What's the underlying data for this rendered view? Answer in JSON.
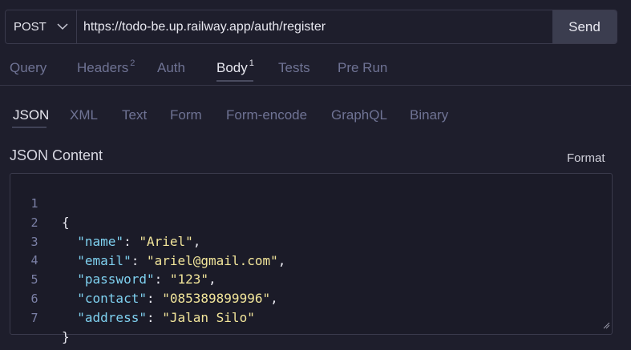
{
  "request": {
    "method": "POST",
    "url": "https://todo-be.up.railway.app/auth/register",
    "send_label": "Send"
  },
  "tabs": [
    {
      "label": "Query",
      "badge": ""
    },
    {
      "label": "Headers",
      "badge": "2"
    },
    {
      "label": "Auth",
      "badge": ""
    },
    {
      "label": "Body",
      "badge": "1"
    },
    {
      "label": "Tests",
      "badge": ""
    },
    {
      "label": "Pre Run",
      "badge": ""
    }
  ],
  "active_tab": "Body",
  "body_types": [
    "JSON",
    "XML",
    "Text",
    "Form",
    "Form-encode",
    "GraphQL",
    "Binary"
  ],
  "active_body_type": "JSON",
  "editor": {
    "title": "JSON Content",
    "format_label": "Format",
    "lines": [
      {
        "num": "1",
        "key": "",
        "value": "",
        "prefix": "{",
        "suffix": ""
      },
      {
        "num": "2",
        "key": "\"name\"",
        "value": "\"Ariel\"",
        "prefix": "  ",
        "suffix": ","
      },
      {
        "num": "3",
        "key": "\"email\"",
        "value": "\"ariel@gmail.com\"",
        "prefix": "  ",
        "suffix": ","
      },
      {
        "num": "4",
        "key": "\"password\"",
        "value": "\"123\"",
        "prefix": "  ",
        "suffix": ","
      },
      {
        "num": "5",
        "key": "\"contact\"",
        "value": "\"085389899996\"",
        "prefix": "  ",
        "suffix": ","
      },
      {
        "num": "6",
        "key": "\"address\"",
        "value": "\"Jalan Silo\"",
        "prefix": "  ",
        "suffix": ""
      },
      {
        "num": "7",
        "key": "",
        "value": "",
        "prefix": "}",
        "suffix": ""
      }
    ]
  },
  "colors": {
    "background": "#1e1e2c",
    "json_key": "#7fd1f0",
    "json_string": "#f2e59a",
    "inactive_tab": "#6f7394",
    "send_button_bg": "#3b3d4f"
  }
}
